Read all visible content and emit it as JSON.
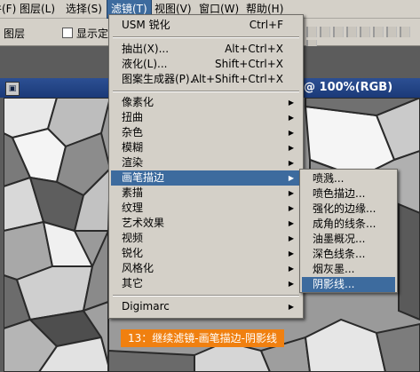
{
  "menubar": {
    "items": [
      {
        "label": "件(F)"
      },
      {
        "label": "图层(L)"
      },
      {
        "label": "选择(S)"
      },
      {
        "label": "滤镜(T)"
      },
      {
        "label": "视图(V)"
      },
      {
        "label": "窗口(W)"
      },
      {
        "label": "帮助(H)"
      }
    ]
  },
  "options_bar": {
    "layer_label": "图层",
    "show_label": "显示定"
  },
  "document": {
    "title": "@ 100%(RGB)",
    "icon": "document-icon"
  },
  "filter_menu": {
    "items": [
      {
        "label": "USM 锐化",
        "shortcut": "Ctrl+F"
      },
      {
        "label": "抽出(X)...",
        "shortcut": "Alt+Ctrl+X"
      },
      {
        "label": "液化(L)...",
        "shortcut": "Shift+Ctrl+X"
      },
      {
        "label": "图案生成器(P)...",
        "shortcut": "Alt+Shift+Ctrl+X"
      },
      {
        "label": "像素化"
      },
      {
        "label": "扭曲"
      },
      {
        "label": "杂色"
      },
      {
        "label": "模糊"
      },
      {
        "label": "渲染"
      },
      {
        "label": "画笔描边"
      },
      {
        "label": "素描"
      },
      {
        "label": "纹理"
      },
      {
        "label": "艺术效果"
      },
      {
        "label": "视频"
      },
      {
        "label": "锐化"
      },
      {
        "label": "风格化"
      },
      {
        "label": "其它"
      },
      {
        "label": "Digimarc"
      }
    ]
  },
  "brush_submenu": {
    "items": [
      {
        "label": "喷溅..."
      },
      {
        "label": "喷色描边..."
      },
      {
        "label": "强化的边缘..."
      },
      {
        "label": "成角的线条..."
      },
      {
        "label": "油墨概况..."
      },
      {
        "label": "深色线条..."
      },
      {
        "label": "烟灰墨..."
      },
      {
        "label": "阴影线..."
      }
    ]
  },
  "caption": "13：继续滤镜-画笔描边-阴影线",
  "colors": {
    "highlight": "#3d6b9e",
    "menu_bg": "#d4d0c8",
    "caption_bg": "#f08010",
    "title_bar": "#1b3a78"
  }
}
